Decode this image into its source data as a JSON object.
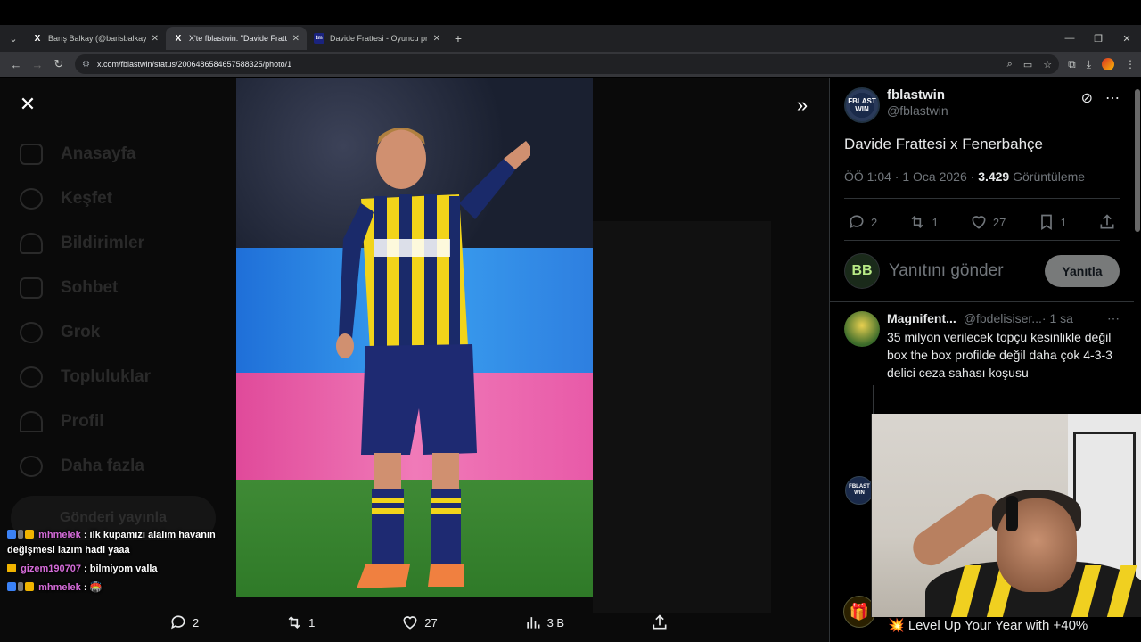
{
  "browser": {
    "tabs": [
      {
        "favicon": "X",
        "title": "Barış Balkay (@barisbalkay) / X",
        "active": false
      },
      {
        "favicon": "X",
        "title": "X'te fblastwin: \"Davide Frattesi",
        "active": true
      },
      {
        "favicon": "tm",
        "title": "Davide Frattesi - Oyuncu profili",
        "active": false
      }
    ],
    "url": "x.com/fblastwin/status/2006486584657588325/photo/1"
  },
  "viewer": {
    "dim_sidebar": [
      "Anasayfa",
      "Keşfet",
      "Bildirimler",
      "Sohbet",
      "Grok",
      "Topluluklar",
      "Profil",
      "Daha fazla"
    ],
    "dim_post_button": "Gönderi yayınla",
    "actions": {
      "replies": "2",
      "reposts": "1",
      "likes": "27",
      "views": "3 B"
    }
  },
  "chat": [
    {
      "user": "mhmelek",
      "message": ": ilk kupamızı alalım havanın değişmesi lazım hadi yaaa"
    },
    {
      "user": "gizem190707",
      "message": ": bilmiyom valla"
    },
    {
      "user": "mhmelek",
      "message": ": 🏟️"
    }
  ],
  "tweet": {
    "display_name": "fblastwin",
    "handle": "@fblastwin",
    "avatar_text": "FBLAST WIN",
    "text": "Davide Frattesi x Fenerbahçe",
    "time": "ÖÖ 1:04 · 1 Oca 2026 · ",
    "views_count": "3.429",
    "views_label": " Görüntüleme",
    "stats": {
      "replies": "2",
      "reposts": "1",
      "likes": "27",
      "bookmarks": "1"
    }
  },
  "reply_box": {
    "avatar_text": "BB",
    "placeholder": "Yanıtını gönder",
    "button": "Yanıtla"
  },
  "replies": [
    {
      "name": "Magnifent...",
      "handle": "@fbdelisiser...",
      "time": " · 1 sa",
      "text": "35 milyon verilecek topçu kesinlikle değil box the box profilde değil daha çok 4-3-3 delici ceza sahası koşusu"
    }
  ],
  "promo": {
    "text": "💥 Level Up Your Year with +40%"
  },
  "colors": {
    "accent": "#1d9bf0",
    "bg": "#000000",
    "muted": "#71767b",
    "chat_user": "#d46bd8"
  }
}
